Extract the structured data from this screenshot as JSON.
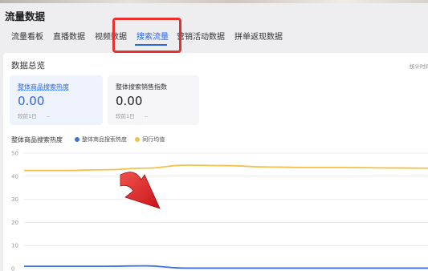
{
  "page": {
    "title": "流量数据"
  },
  "tabs": [
    {
      "label": "流量看板",
      "active": false
    },
    {
      "label": "直播数据",
      "active": false
    },
    {
      "label": "视频数据",
      "active": false
    },
    {
      "label": "搜索流量",
      "active": true
    },
    {
      "label": "营销活动数据",
      "active": false
    },
    {
      "label": "拼单返现数据",
      "active": false
    }
  ],
  "overview": {
    "title": "数据总览",
    "stat_time": "统计时间",
    "metrics": [
      {
        "label": "整体商品搜索热度",
        "value": "0.00",
        "compare_label": "较前1日",
        "compare_value": "--"
      },
      {
        "label": "整体搜索销售指数",
        "value": "0.00",
        "compare_label": "较前1日",
        "compare_value": "--"
      }
    ]
  },
  "colors": {
    "accent": "#2a66e6",
    "highlight": "#e8312f",
    "series_blue": "#3f72e0",
    "series_yellow": "#f2c24a"
  },
  "chart_data": {
    "type": "line",
    "title": "整体商品搜索热度",
    "ylim": [
      0,
      50
    ],
    "yticks": [
      "0",
      "10",
      "20",
      "30",
      "40",
      "50"
    ],
    "grid": true,
    "legend": "top-left",
    "x": [
      0,
      1,
      2,
      3,
      4,
      5,
      6,
      7,
      8,
      9,
      10
    ],
    "series": [
      {
        "name": "整体商品搜索热度",
        "color": "#3f72e0",
        "values": [
          1,
          1,
          1,
          1.2,
          0.2,
          0.2,
          0.2,
          0.2,
          0.2,
          0.2,
          0.2
        ]
      },
      {
        "name": "同行均值",
        "color": "#f2c24a",
        "values": [
          42.5,
          42.5,
          42.8,
          43.5,
          44.8,
          44.6,
          44,
          43.8,
          43.8,
          43.6,
          43.5
        ]
      }
    ]
  },
  "annotation": {
    "arrow": "red-arrow"
  }
}
